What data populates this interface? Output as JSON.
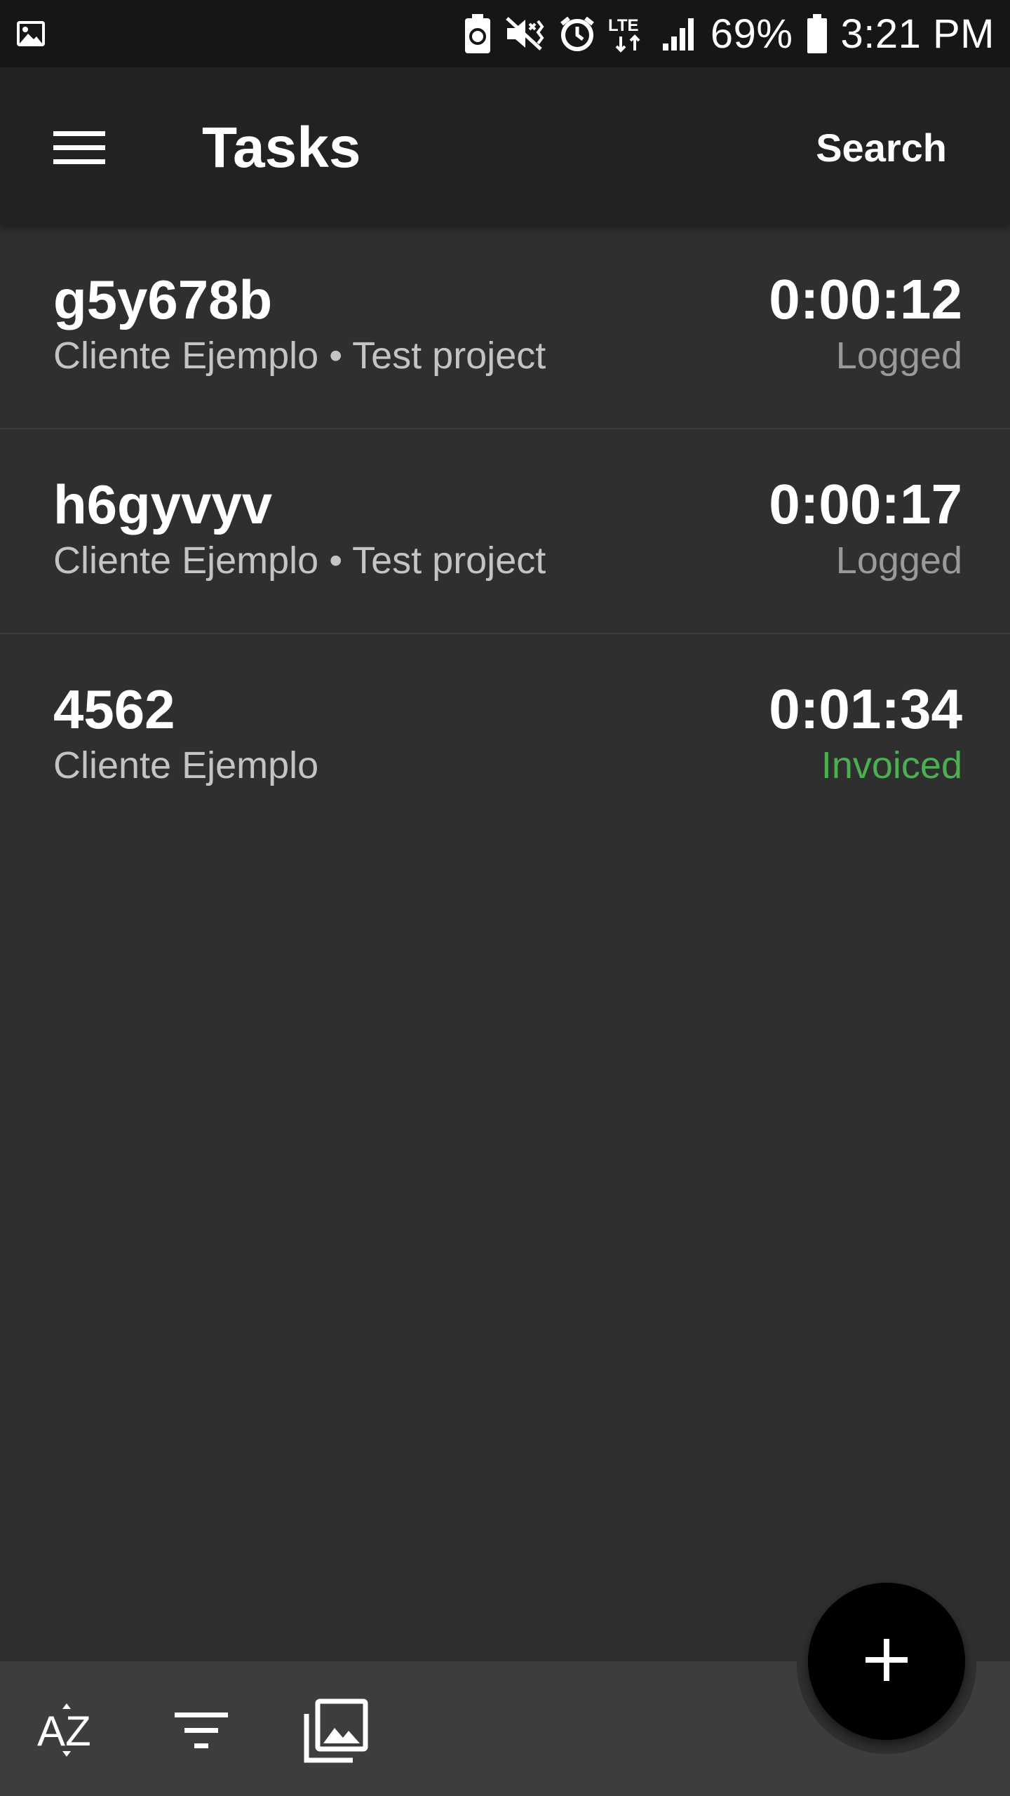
{
  "status_bar": {
    "battery_percent": "69%",
    "time": "3:21 PM",
    "icons": [
      "gallery-icon",
      "battery-saver-icon",
      "mute-vibrate-icon",
      "alarm-icon",
      "lte-icon",
      "signal-icon",
      "battery-icon"
    ]
  },
  "app_bar": {
    "menu_icon": "hamburger-menu-icon",
    "title": "Tasks",
    "search_label": "Search"
  },
  "tasks": [
    {
      "name": "g5y678b",
      "subtitle": "Cliente Ejemplo • Test project",
      "duration": "0:00:12",
      "status": "Logged"
    },
    {
      "name": "h6gyvyv",
      "subtitle": "Cliente Ejemplo • Test project",
      "duration": "0:00:17",
      "status": "Logged"
    },
    {
      "name": "4562",
      "subtitle": "Cliente Ejemplo",
      "duration": "0:01:34",
      "status": "Invoiced"
    }
  ],
  "bottom_bar": {
    "icons": [
      "sort-az-icon",
      "filter-icon",
      "gallery-stack-icon"
    ],
    "fab_icon": "add-icon"
  },
  "colors": {
    "background": "#2f2f2f",
    "app_bar": "#222222",
    "status_bar": "#161616",
    "invoiced": "#4caf50",
    "logged": "#9a9a9a",
    "bottom_bar": "#3d3d3d",
    "fab": "#000000"
  }
}
